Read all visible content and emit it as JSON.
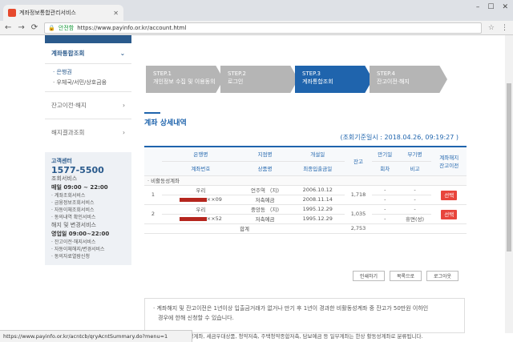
{
  "browser": {
    "tab_title": "계좌정보통합관리서비스",
    "url_secure": "안전함",
    "url": "https://www.payinfo.or.kr/account.html",
    "status_url": "https://www.payinfo.or.kr/acntcb/qryAcntSummary.do?menu=1"
  },
  "sidebar": {
    "head": "계좌통합조회",
    "sub": [
      "· 은행권",
      "· 우체국/서민/상호금융"
    ],
    "items": [
      "잔고이전·해지",
      "해지결과조회"
    ],
    "cs": {
      "label": "고객센터",
      "tel": "1577-5500",
      "a": "조회서비스",
      "a_time": "매일 09:00 ~ 22:00",
      "a_list": "· 계좌조회서비스\n· 금융정보조회서비스\n· 자동이체조회서비스\n· 동의내역 확인서비스",
      "b": "해지 및 변경서비스",
      "b_time": "영업일 09:00~22:00",
      "b_list": "· 잔고이전·해지서비스\n· 자동이체해지/변경서비스\n· 동의자료열람신청"
    }
  },
  "steps": [
    {
      "n": "STEP.1",
      "t": "개인정보 수집 및 이용동의"
    },
    {
      "n": "STEP.2",
      "t": "로그인"
    },
    {
      "n": "STEP.3",
      "t": "계좌통합조회"
    },
    {
      "n": "STEP.4",
      "t": "잔고이전·해지"
    }
  ],
  "main": {
    "title": "계좌 상세내역",
    "base": "(조회기준일시 : 2018.04.26, 09:19:27 )",
    "head": [
      "은행명",
      "지점명",
      "개설일",
      "잔고",
      "만기일",
      "부기명",
      "계좌해지\n잔고이전"
    ],
    "head2": [
      "계좌번호",
      "상품명",
      "최종입출금일",
      "회차",
      "비고"
    ],
    "cat": "· 비활동성계좌",
    "rows": [
      {
        "no": "1",
        "bank": "우리",
        "acct_suffix": "××09",
        "branch": "언주역 （지)",
        "product": "저축예금",
        "open": "2006.10.12",
        "last": "2008.11.14",
        "bal": "1,718",
        "mat": "-",
        "mat2": "-",
        "memo": "-",
        "memo2": "-",
        "btn": "선택"
      },
      {
        "no": "2",
        "bank": "우리",
        "acct_suffix": "××52",
        "branch": "중앙동 （지)",
        "product": "저축예금",
        "open": "1995.12.29",
        "last": "1995.12.29",
        "bal": "1,035",
        "mat": "-",
        "mat2": "-",
        "memo": "-",
        "memo2": "휴면(성)",
        "btn": "선택"
      }
    ],
    "total_label": "합계",
    "total": "2,753",
    "buttons": [
      "인쇄하기",
      "목록으로",
      "로그아웃"
    ],
    "notice1": "· 계좌해지 및 잔고이전은 1년이상 입출금거래가 없거나 만기 후 1년이 경과한 비활동성계좌 중 잔고가 50만원 이하인",
    "notice2": "경우에 한해 신청할 수 있습니다.",
    "footer": "※ 대출약정계좌, 세금우대상품, 청약저축, 주택청약종합저축, 담보예금 등 일부계좌는 한상 활동성계좌로 분류됩니다."
  }
}
